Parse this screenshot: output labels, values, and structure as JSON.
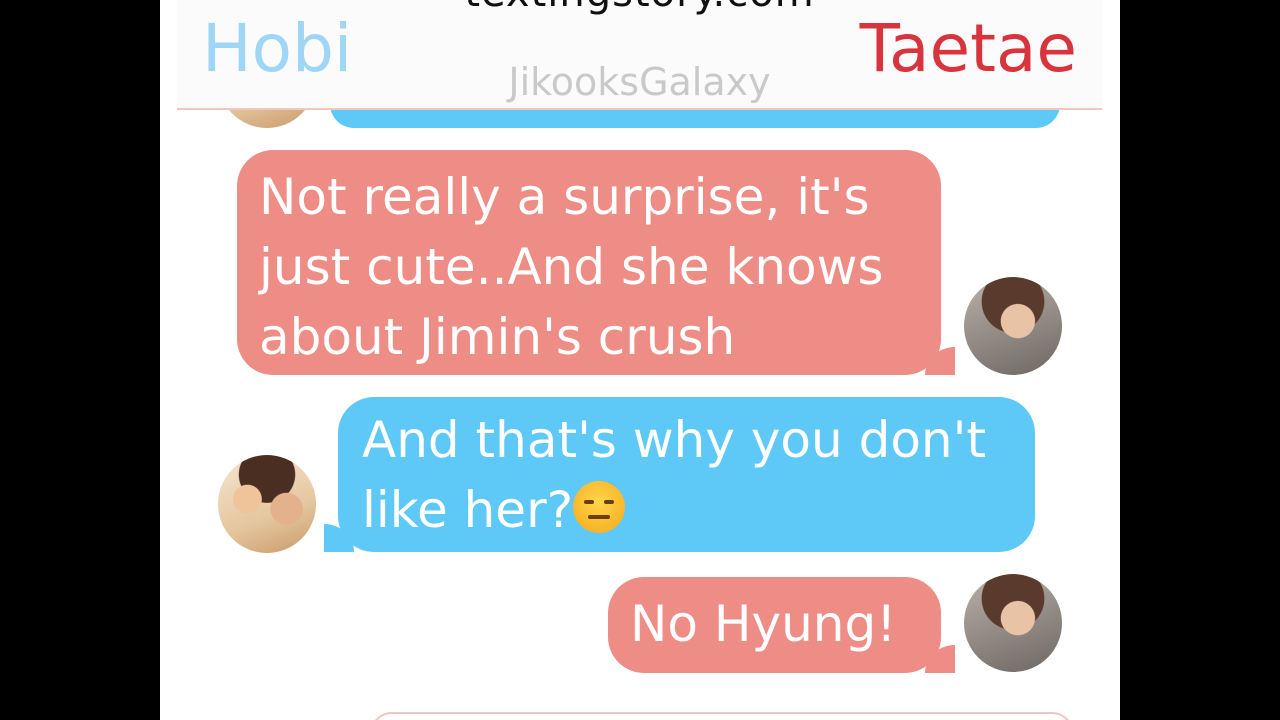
{
  "header": {
    "site_url": "textingstory.com",
    "contact_left": "Hobi",
    "contact_right": "Taetae",
    "watermark": "JikooksGalaxy"
  },
  "messages": [
    {
      "sender": "Taetae",
      "side": "right",
      "color": "red",
      "text": "Not really a surprise, it's just cute..And she knows about Jimin's crush"
    },
    {
      "sender": "Hobi",
      "side": "left",
      "color": "blue",
      "text": "And that's why you don't like her?",
      "emoji": "expressionless-face-icon"
    },
    {
      "sender": "Taetae",
      "side": "right",
      "color": "red",
      "text": "No Hyung!"
    }
  ],
  "colors": {
    "hobi_name": "#9fd6f5",
    "taetae_name": "#d8343d",
    "red_bubble": "#ee8c86",
    "blue_bubble": "#5ec8f6"
  }
}
